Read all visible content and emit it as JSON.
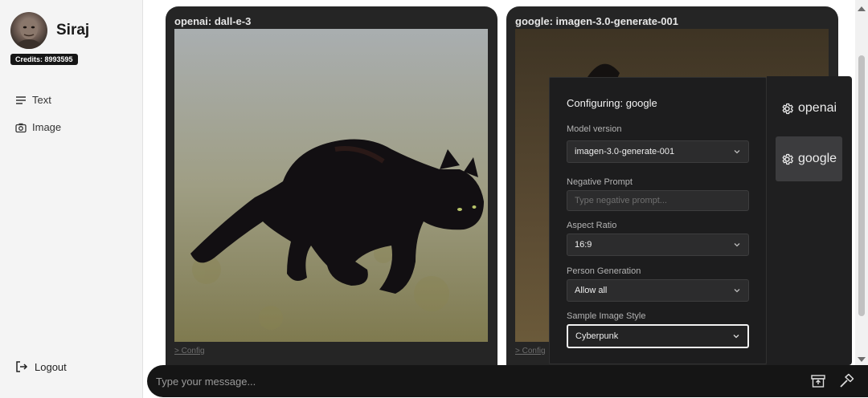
{
  "user": {
    "name": "Siraj",
    "credits": "Credits: 8993595"
  },
  "nav": {
    "items": [
      {
        "label": "Text",
        "icon": "menu-lines-icon"
      },
      {
        "label": "Image",
        "icon": "camera-icon"
      }
    ],
    "logout": "Logout"
  },
  "cards": [
    {
      "title": "openai: dall-e-3",
      "config_link": "> Config"
    },
    {
      "title": "google: imagen-3.0-generate-001",
      "config_link": "> Config"
    }
  ],
  "config": {
    "title": "Configuring: google",
    "fields": {
      "model_version": {
        "label": "Model version",
        "value": "imagen-3.0-generate-001"
      },
      "negative_prompt": {
        "label": "Negative Prompt",
        "placeholder": "Type negative prompt..."
      },
      "aspect_ratio": {
        "label": "Aspect Ratio",
        "value": "16:9"
      },
      "person_generation": {
        "label": "Person Generation",
        "value": "Allow all"
      },
      "sample_image_style": {
        "label": "Sample Image Style",
        "value": "Cyberpunk"
      }
    }
  },
  "providers": [
    {
      "name": "openai",
      "icon": "gear-icon",
      "selected": false
    },
    {
      "name": "google",
      "icon": "gear-icon",
      "selected": true
    }
  ],
  "message": {
    "placeholder": "Type your message..."
  },
  "colors": {
    "card_bg": "#252525",
    "panel_bg": "#1d1d1e",
    "accent_selected": "#3c3c3e",
    "sidebar_bg": "#f4f4f4"
  }
}
